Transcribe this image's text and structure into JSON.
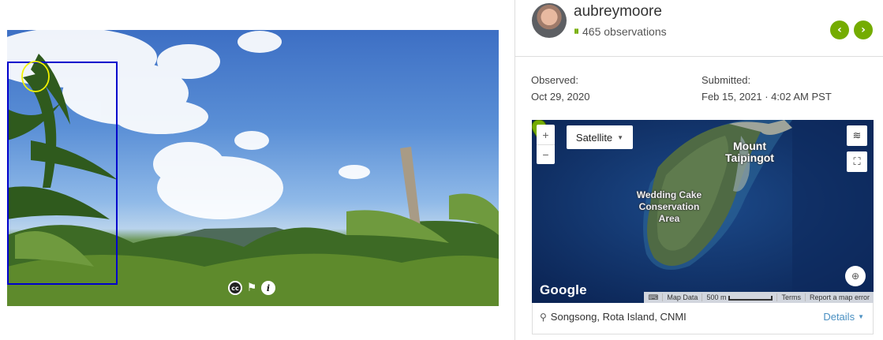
{
  "photo": {
    "controls": {
      "license_icon": "creative-commons-icon",
      "flag_icon": "flag-icon",
      "info_icon": "info-icon"
    },
    "colors": {
      "annotation_box": "#0000cc",
      "annotation_circle": "#f2f200"
    }
  },
  "user": {
    "name": "aubreymoore",
    "observations": "465 observations"
  },
  "nav": {
    "prev_icon": "chevron-left-icon",
    "next_icon": "chevron-right-icon",
    "accent": "#74ac00"
  },
  "observed": {
    "label": "Observed:",
    "value": "Oct 29, 2020"
  },
  "submitted": {
    "label": "Submitted:",
    "value": "Feb 15, 2021 · 4:02 AM PST"
  },
  "map": {
    "zoom_in": "+",
    "zoom_out": "−",
    "map_type": "Satellite",
    "labels": {
      "peak": "Mount Taipingot",
      "area": "Wedding Cake Conservation Area"
    },
    "provider": "Google",
    "attribution": {
      "map_data": "Map Data",
      "scale": "500 m",
      "terms": "Terms",
      "report": "Report a map error"
    }
  },
  "place": {
    "name": "Songsong, Rota Island, CNMI",
    "details": "Details"
  }
}
